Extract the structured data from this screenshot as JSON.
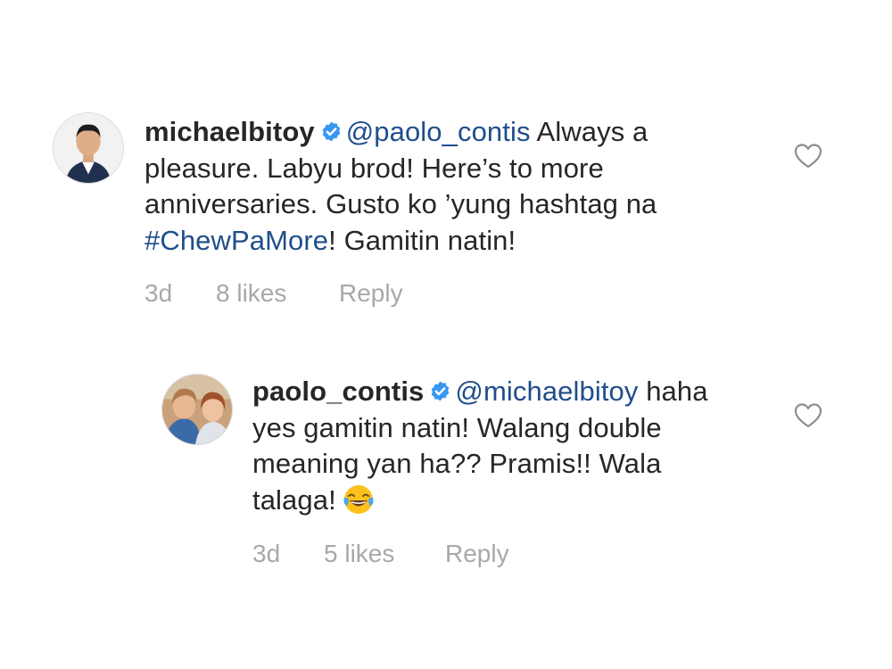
{
  "comments": [
    {
      "username": "michaelbitoy",
      "mention": "@paolo_contis",
      "text_a": " Always a pleasure. Labyu brod! Here’s to more anniversaries. Gusto ko ’yung hashtag na ",
      "hashtag": "#ChewPaMore",
      "text_b": "! Gamitin natin!",
      "time": "3d",
      "likes": "8 likes",
      "reply_label": "Reply"
    },
    {
      "username": "paolo_contis",
      "mention": "@michaelbitoy",
      "text_a": " haha yes gamitin natin! Walang double meaning yan ha?? Pramis!! Wala talaga!",
      "emoji": "face-with-tears-of-joy",
      "time": "3d",
      "likes": "5 likes",
      "reply_label": "Reply"
    }
  ],
  "icons": {
    "verified": "verified-badge-icon",
    "like": "heart-outline-icon"
  },
  "colors": {
    "text": "#262626",
    "link": "#1f4e8a",
    "meta": "#a8a8a8",
    "verified": "#3897f0"
  }
}
